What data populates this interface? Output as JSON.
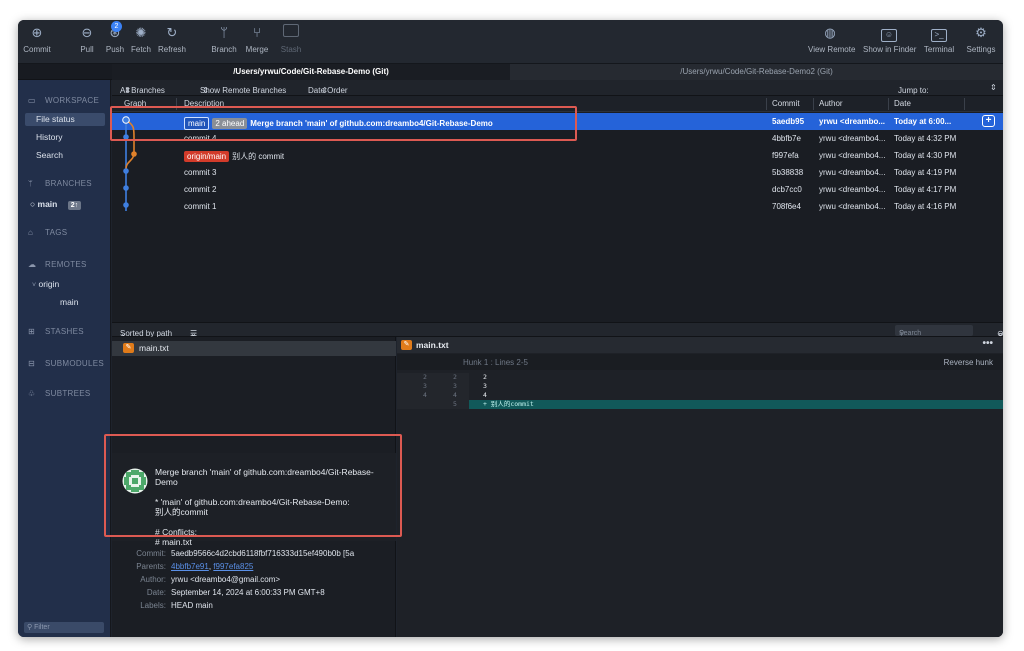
{
  "toolbar": {
    "commit": "Commit",
    "pull": "Pull",
    "push": "Push",
    "push_badge": "2",
    "fetch": "Fetch",
    "refresh": "Refresh",
    "branch": "Branch",
    "merge": "Merge",
    "stash": "Stash",
    "view_remote": "View Remote",
    "show_in_finder": "Show in Finder",
    "terminal": "Terminal",
    "settings": "Settings"
  },
  "repo_tabs": {
    "active": "/Users/yrwu/Code/Git-Rebase-Demo (Git)",
    "inactive": "/Users/yrwu/Code/Git-Rebase-Demo2 (Git)"
  },
  "sidebar": {
    "workspace": "WORKSPACE",
    "file_status": "File status",
    "history": "History",
    "search": "Search",
    "branches": "BRANCHES",
    "branch_main": "main",
    "branch_main_badge": "2↑",
    "tags": "TAGS",
    "remotes": "REMOTES",
    "remote_origin": "origin",
    "remote_main": "main",
    "stashes": "STASHES",
    "submodules": "SUBMODULES",
    "subtrees": "SUBTREES",
    "filter_placeholder": "Filter"
  },
  "list_filter": {
    "all_branches": "All Branches",
    "show_remote": "Show Remote Branches",
    "date_order": "Date Order",
    "jump_to": "Jump to:"
  },
  "columns": {
    "graph": "Graph",
    "description": "Description",
    "commit": "Commit",
    "author": "Author",
    "date": "Date"
  },
  "commits": [
    {
      "tag_local": "main",
      "tag_ahead": "2 ahead",
      "tag_remote": "",
      "desc": "Merge branch 'main' of github.com:dreambo4/Git-Rebase-Demo",
      "hash": "5aedb95",
      "author": "yrwu <dreambo...",
      "date": "Today at 6:00..."
    },
    {
      "tag_local": "",
      "tag_ahead": "",
      "tag_remote": "",
      "desc": "commit 4",
      "hash": "4bbfb7e",
      "author": "yrwu <dreambo4...",
      "date": "Today at 4:32 PM"
    },
    {
      "tag_local": "",
      "tag_ahead": "",
      "tag_remote": "origin/main",
      "desc": "别人的 commit",
      "hash": "f997efa",
      "author": "yrwu <dreambo4...",
      "date": "Today at 4:30 PM"
    },
    {
      "tag_local": "",
      "tag_ahead": "",
      "tag_remote": "",
      "desc": "commit 3",
      "hash": "5b38838",
      "author": "yrwu <dreambo4...",
      "date": "Today at 4:19 PM"
    },
    {
      "tag_local": "",
      "tag_ahead": "",
      "tag_remote": "",
      "desc": "commit 2",
      "hash": "dcb7cc0",
      "author": "yrwu <dreambo4...",
      "date": "Today at 4:17 PM"
    },
    {
      "tag_local": "",
      "tag_ahead": "",
      "tag_remote": "",
      "desc": "commit 1",
      "hash": "708f6e4",
      "author": "yrwu <dreambo4...",
      "date": "Today at 4:16 PM"
    }
  ],
  "bottom": {
    "sorted_by": "Sorted by path",
    "search_placeholder": "Search"
  },
  "files": [
    {
      "name": "main.txt"
    }
  ],
  "diff": {
    "file": "main.txt",
    "hunk": "Hunk 1 : Lines 2-5",
    "reverse": "Reverse hunk",
    "more": "•••",
    "lines": [
      {
        "old": "2",
        "new": "2",
        "code": "2"
      },
      {
        "old": "3",
        "new": "3",
        "code": "3"
      },
      {
        "old": "4",
        "new": "4",
        "code": "4"
      },
      {
        "old": "",
        "new": "5",
        "code": "+ 别人的commit"
      }
    ]
  },
  "commit_detail": {
    "title": "Merge branch 'main' of github.com:dreambo4/Git-Rebase-Demo",
    "body1": "* 'main' of github.com:dreambo4/Git-Rebase-Demo:",
    "body2": "别人的commit",
    "body3": "# Conflicts:",
    "body4": "# main.txt",
    "commit_label": "Commit:",
    "commit_value": "5aedb9566c4d2cbd6118fbf716333d15ef490b0b [5a",
    "parents_label": "Parents:",
    "parent1": "4bbfb7e91",
    "parent_sep": ",",
    "parent2": "f997efa825",
    "author_label": "Author:",
    "author_value": "yrwu <dreambo4@gmail.com>",
    "date_label": "Date:",
    "date_value": "September 14, 2024 at 6:00:33 PM GMT+8",
    "labels_label": "Labels:",
    "labels_value": "HEAD main"
  },
  "colors": {
    "selected_row": "#2563d9",
    "sidebar_bg": "#222f4a",
    "annotation": "#dd5a52",
    "remote_tag": "#d23b2a"
  }
}
